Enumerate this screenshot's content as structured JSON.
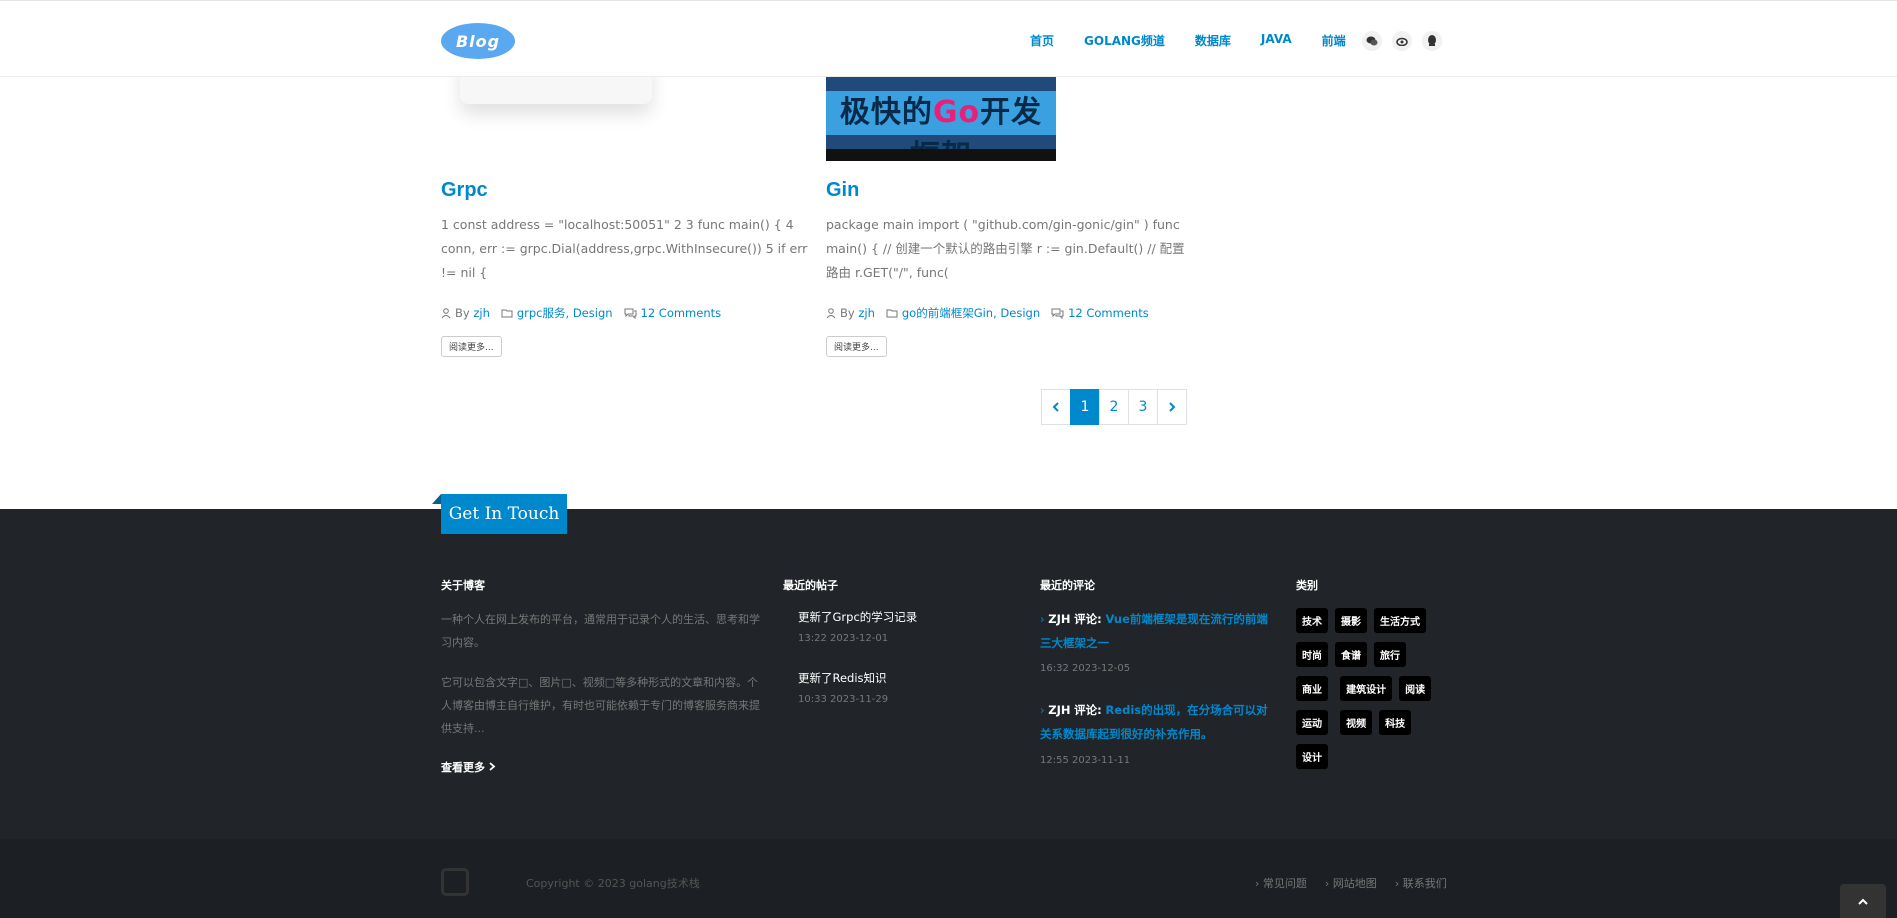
{
  "header": {
    "logo_text": "Blog",
    "nav": [
      "首页",
      "GOLANG频道",
      "数据库",
      "JAVA",
      "前端"
    ],
    "social_icons": [
      "wechat-icon",
      "weibo-icon",
      "qq-icon"
    ]
  },
  "posts": [
    {
      "title": "Grpc",
      "excerpt": "1 const address = \"localhost:50051\" 2 3 func main() { 4 conn, err := grpc.Dial(address,grpc.WithInsecure()) 5 if err != nil {",
      "author_prefix": "By",
      "author": "zjh",
      "categories": "grpc服务, Design",
      "comments": "12 Comments",
      "read_more": "阅读更多..."
    },
    {
      "title": "Gin",
      "thumb_text_1": "极快的",
      "thumb_text_go": "Go",
      "thumb_text_2": "开发框架",
      "excerpt": "package main import ( \"github.com/gin-gonic/gin\" ) func main() { // 创建一个默认的路由引擎 r := gin.Default() // 配置路由 r.GET(\"/\", func(",
      "author_prefix": "By",
      "author": "zjh",
      "categories": "go的前端框架Gin, Design",
      "comments": "12 Comments",
      "read_more": "阅读更多..."
    }
  ],
  "pagination": {
    "pages": [
      "1",
      "2",
      "3"
    ],
    "current": "1"
  },
  "footer": {
    "get_in_touch": "Get In Touch",
    "about": {
      "title": "关于博客",
      "p1": "一种个人在网上发布的平台，通常用于记录个人的生活、思考和学习内容。",
      "p2": "它可以包含文字□、图片□、视频□等多种形式的文章和内容。个人博客由博主自行维护，有时也可能依赖于专门的博客服务商来提供支持...",
      "more": "查看更多"
    },
    "recent_posts": {
      "title": "最近的帖子",
      "items": [
        {
          "title": "更新了Grpc的学习记录",
          "date": "13:22 2023-12-01"
        },
        {
          "title": "更新了Redis知识",
          "date": "10:33 2023-11-29"
        }
      ]
    },
    "recent_comments": {
      "title": "最近的评论",
      "items": [
        {
          "who": "ZJH",
          "label": "评论:",
          "text": "Vue前端框架是现在流行的前端三大框架之一",
          "date": "16:32 2023-12-05"
        },
        {
          "who": "ZJH",
          "label": "评论:",
          "text": "Redis的出现，在分场合可以对关系数据库起到很好的补充作用。",
          "date": "12:55 2023-11-11"
        }
      ]
    },
    "categories": {
      "title": "类别",
      "tags": [
        "技术",
        "摄影",
        "生活方式",
        "时尚",
        "食谱",
        "旅行",
        "商业",
        "建筑设计",
        "阅读",
        "运动",
        "视频",
        "科技",
        "设计"
      ]
    },
    "copyright": "Copyright © 2023 golang技术栈",
    "links": [
      "常见问题",
      "网站地图",
      "联系我们"
    ]
  }
}
